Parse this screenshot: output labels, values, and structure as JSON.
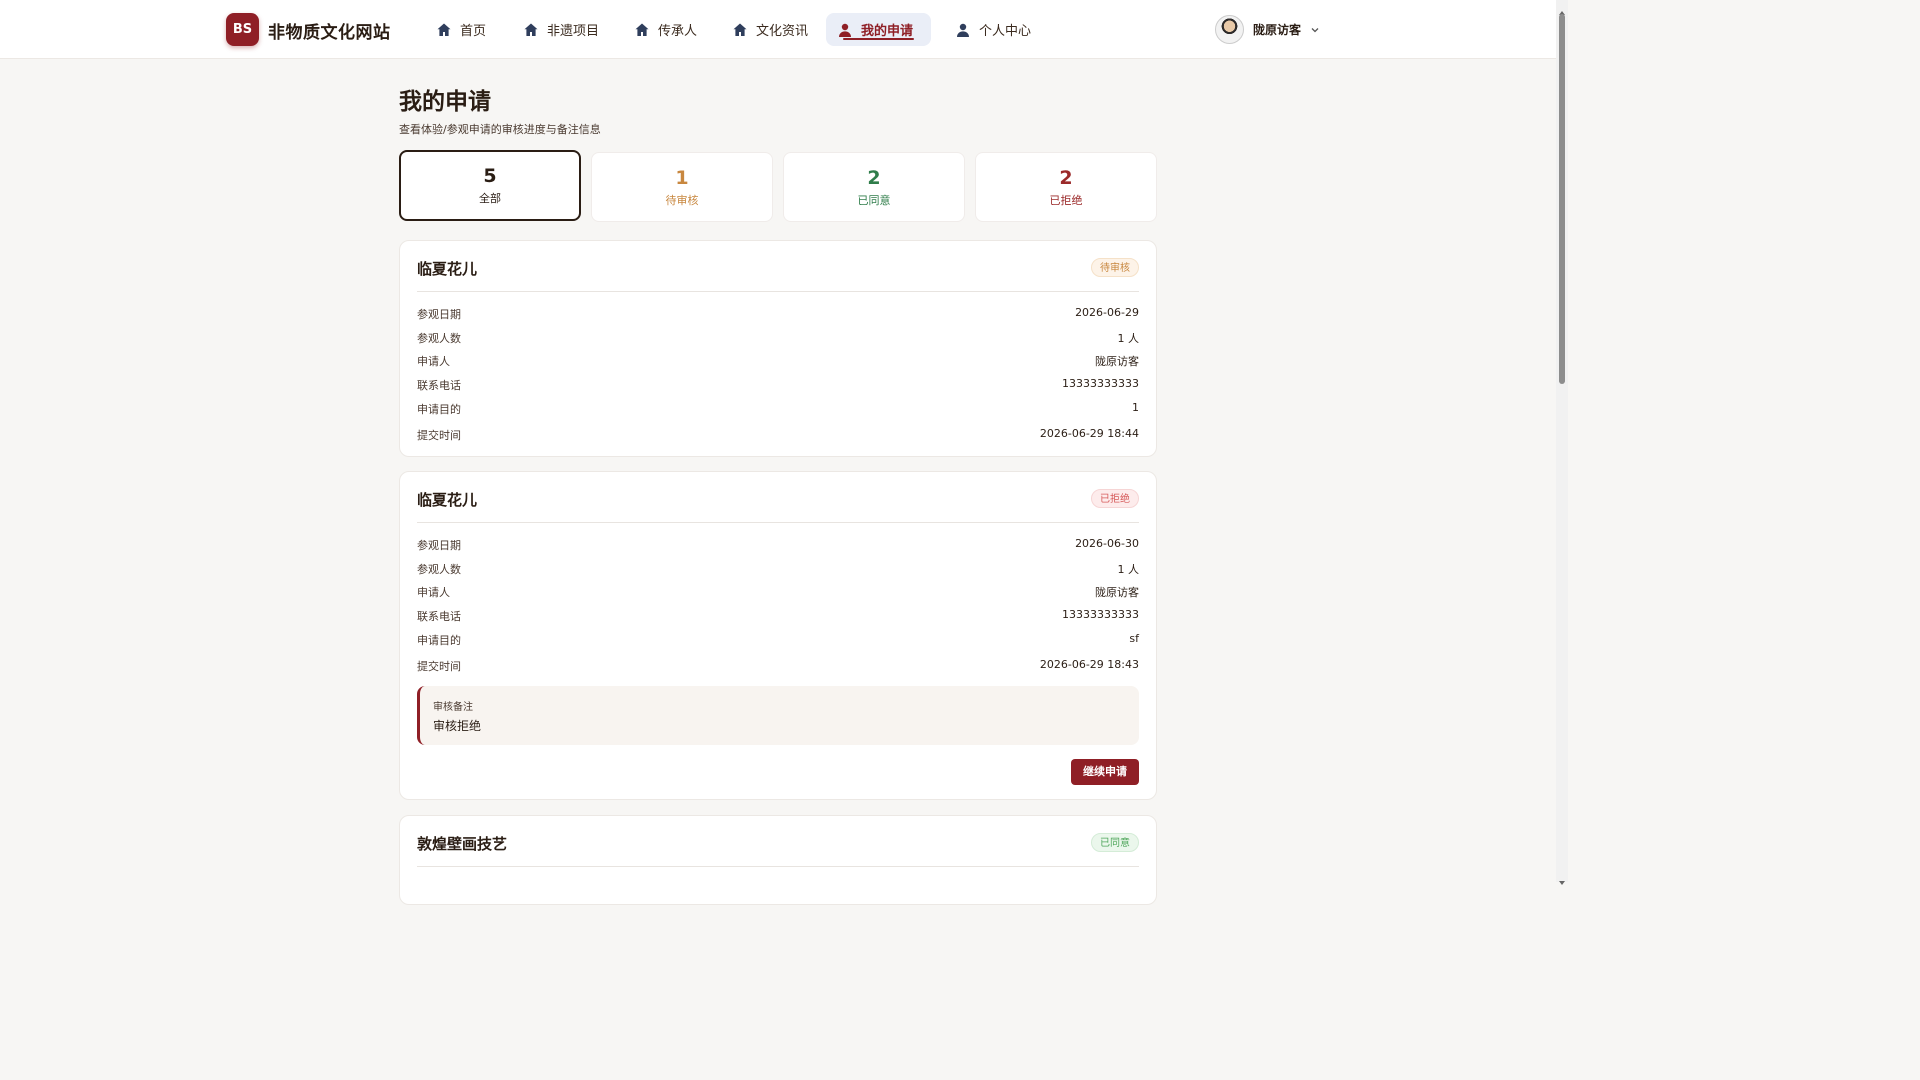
{
  "header": {
    "logo_text": "BS",
    "site_name": "非物质文化网站",
    "nav": [
      {
        "label": "首页",
        "icon": "home-icon"
      },
      {
        "label": "非遗项目",
        "icon": "home-icon"
      },
      {
        "label": "传承人",
        "icon": "home-icon"
      },
      {
        "label": "文化资讯",
        "icon": "home-icon"
      },
      {
        "label": "我的申请",
        "icon": "user-icon",
        "active": true
      },
      {
        "label": "个人中心",
        "icon": "user-icon"
      }
    ],
    "user_name": "陇原访客"
  },
  "page": {
    "title": "我的申请",
    "subtitle": "查看体验/参观申请的审核进度与备注信息"
  },
  "stats": [
    {
      "count": "5",
      "label": "全部",
      "color": "#2a1d14"
    },
    {
      "count": "1",
      "label": "待审核",
      "color": "#c8873f"
    },
    {
      "count": "2",
      "label": "已同意",
      "color": "#2f7d4a"
    },
    {
      "count": "2",
      "label": "已拒绝",
      "color": "#9b2a2a"
    }
  ],
  "applications": [
    {
      "title": "临夏花儿",
      "status": "待审核",
      "fields": [
        {
          "label": "参观日期",
          "value": "2026-06-29"
        },
        {
          "label": "参观人数",
          "value": "1 人"
        },
        {
          "label": "申请人",
          "value": "陇原访客"
        },
        {
          "label": "联系电话",
          "value": "13333333333"
        },
        {
          "label": "申请目的",
          "value": "1"
        },
        {
          "label": "提交时间",
          "value": "2026-06-29 18:44"
        }
      ]
    },
    {
      "title": "临夏花儿",
      "status": "已拒绝",
      "fields": [
        {
          "label": "参观日期",
          "value": "2026-06-30"
        },
        {
          "label": "参观人数",
          "value": "1 人"
        },
        {
          "label": "申请人",
          "value": "陇原访客"
        },
        {
          "label": "联系电话",
          "value": "13333333333"
        },
        {
          "label": "申请目的",
          "value": "sf"
        },
        {
          "label": "提交时间",
          "value": "2026-06-29 18:43"
        }
      ],
      "remark_label": "审核备注",
      "remark": "审核拒绝",
      "action": "继续申请"
    },
    {
      "title": "敦煌壁画技艺",
      "status": "已同意"
    }
  ]
}
